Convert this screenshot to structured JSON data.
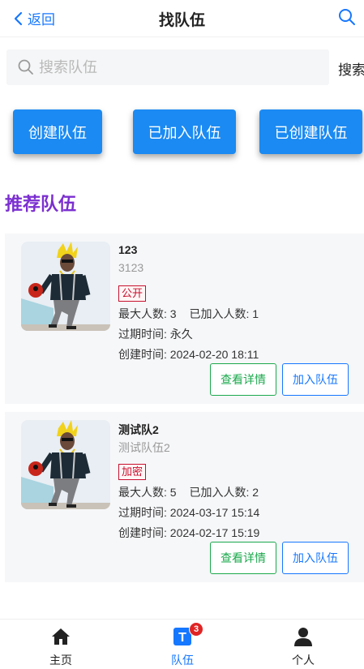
{
  "header": {
    "back_label": "返回",
    "title": "找队伍"
  },
  "search": {
    "placeholder": "搜索队伍",
    "value": "",
    "button_label": "搜索"
  },
  "actions": {
    "create": "创建队伍",
    "joined": "已加入队伍",
    "created": "已创建队伍"
  },
  "section_title": "推荐队伍",
  "labels": {
    "max_members": "最大人数:",
    "joined_members": "已加入人数:",
    "expire_time": "过期时间:",
    "create_time": "创建时间:",
    "view_detail": "查看详情",
    "join_team": "加入队伍"
  },
  "teams": [
    {
      "name": "123",
      "description": "3123",
      "status": "公开",
      "max_members": "3",
      "joined_members": "1",
      "expire_time": "永久",
      "create_time": "2024-02-20 18:11"
    },
    {
      "name": "测试队2",
      "description": "测试队伍2",
      "status": "加密",
      "max_members": "5",
      "joined_members": "2",
      "expire_time": "2024-03-17 15:14",
      "create_time": "2024-02-17 15:19"
    }
  ],
  "tabbar": {
    "items": [
      {
        "label": "主页",
        "icon": "home-icon"
      },
      {
        "label": "队伍",
        "icon": "team-icon",
        "badge": "3",
        "icon_letter": "T"
      },
      {
        "label": "个人",
        "icon": "user-icon"
      }
    ]
  },
  "colors": {
    "primary": "#1b8af2",
    "section_title": "#7b2fd0",
    "badge_red": "#c8102e",
    "detail_green": "#1ba94c"
  }
}
